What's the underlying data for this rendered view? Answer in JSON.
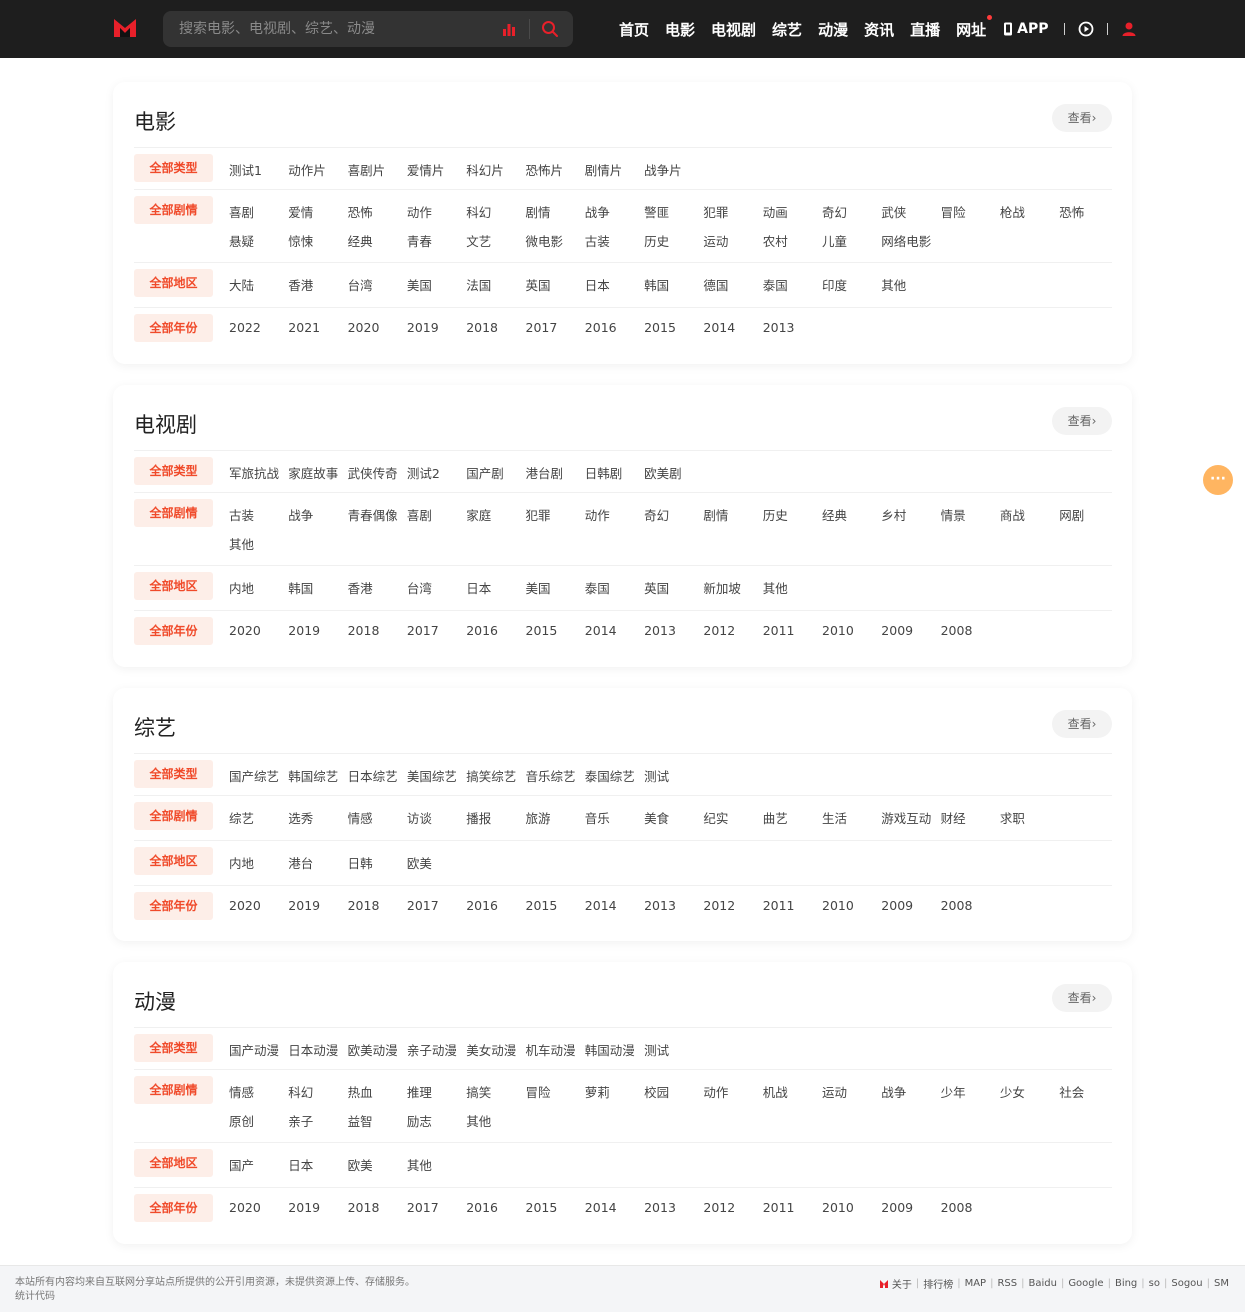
{
  "header": {
    "search_placeholder": "搜索电影、电视剧、综艺、动漫",
    "nav": [
      "首页",
      "电影",
      "电视剧",
      "综艺",
      "动漫",
      "资讯",
      "直播",
      "网址"
    ],
    "app_label": "APP",
    "brand_color": "#e8202a"
  },
  "more_label": "查看›",
  "filter_tags": [
    "全部类型",
    "全部剧情",
    "全部地区",
    "全部年份"
  ],
  "sections": [
    {
      "title": "电影",
      "more_label": "查看›",
      "rows": [
        {
          "tag": "全部类型",
          "items": [
            "测试1",
            "动作片",
            "喜剧片",
            "爱情片",
            "科幻片",
            "恐怖片",
            "剧情片",
            "战争片"
          ]
        },
        {
          "tag": "全部剧情",
          "items": [
            "喜剧",
            "爱情",
            "恐怖",
            "动作",
            "科幻",
            "剧情",
            "战争",
            "警匪",
            "犯罪",
            "动画",
            "奇幻",
            "武侠",
            "冒险",
            "枪战",
            "恐怖",
            "悬疑",
            "惊悚",
            "经典",
            "青春",
            "文艺",
            "微电影",
            "古装",
            "历史",
            "运动",
            "农村",
            "儿童",
            "网络电影"
          ]
        },
        {
          "tag": "全部地区",
          "items": [
            "大陆",
            "香港",
            "台湾",
            "美国",
            "法国",
            "英国",
            "日本",
            "韩国",
            "德国",
            "泰国",
            "印度",
            "其他"
          ]
        },
        {
          "tag": "全部年份",
          "items": [
            "2022",
            "2021",
            "2020",
            "2019",
            "2018",
            "2017",
            "2016",
            "2015",
            "2014",
            "2013"
          ]
        }
      ]
    },
    {
      "title": "电视剧",
      "more_label": "查看›",
      "rows": [
        {
          "tag": "全部类型",
          "items": [
            "军旅抗战",
            "家庭故事",
            "武侠传奇",
            "测试2",
            "国产剧",
            "港台剧",
            "日韩剧",
            "欧美剧"
          ]
        },
        {
          "tag": "全部剧情",
          "items": [
            "古装",
            "战争",
            "青春偶像",
            "喜剧",
            "家庭",
            "犯罪",
            "动作",
            "奇幻",
            "剧情",
            "历史",
            "经典",
            "乡村",
            "情景",
            "商战",
            "网剧",
            "其他"
          ]
        },
        {
          "tag": "全部地区",
          "items": [
            "内地",
            "韩国",
            "香港",
            "台湾",
            "日本",
            "美国",
            "泰国",
            "英国",
            "新加坡",
            "其他"
          ]
        },
        {
          "tag": "全部年份",
          "items": [
            "2020",
            "2019",
            "2018",
            "2017",
            "2016",
            "2015",
            "2014",
            "2013",
            "2012",
            "2011",
            "2010",
            "2009",
            "2008"
          ]
        }
      ]
    },
    {
      "title": "综艺",
      "more_label": "查看›",
      "rows": [
        {
          "tag": "全部类型",
          "items": [
            "国产综艺",
            "韩国综艺",
            "日本综艺",
            "美国综艺",
            "搞笑综艺",
            "音乐综艺",
            "泰国综艺",
            "测试"
          ]
        },
        {
          "tag": "全部剧情",
          "items": [
            "综艺",
            "选秀",
            "情感",
            "访谈",
            "播报",
            "旅游",
            "音乐",
            "美食",
            "纪实",
            "曲艺",
            "生活",
            "游戏互动",
            "财经",
            "求职"
          ]
        },
        {
          "tag": "全部地区",
          "items": [
            "内地",
            "港台",
            "日韩",
            "欧美"
          ]
        },
        {
          "tag": "全部年份",
          "items": [
            "2020",
            "2019",
            "2018",
            "2017",
            "2016",
            "2015",
            "2014",
            "2013",
            "2012",
            "2011",
            "2010",
            "2009",
            "2008"
          ]
        }
      ]
    },
    {
      "title": "动漫",
      "more_label": "查看›",
      "rows": [
        {
          "tag": "全部类型",
          "items": [
            "国产动漫",
            "日本动漫",
            "欧美动漫",
            "亲子动漫",
            "美女动漫",
            "机车动漫",
            "韩国动漫",
            "测试"
          ]
        },
        {
          "tag": "全部剧情",
          "items": [
            "情感",
            "科幻",
            "热血",
            "推理",
            "搞笑",
            "冒险",
            "萝莉",
            "校园",
            "动作",
            "机战",
            "运动",
            "战争",
            "少年",
            "少女",
            "社会",
            "原创",
            "亲子",
            "益智",
            "励志",
            "其他"
          ]
        },
        {
          "tag": "全部地区",
          "items": [
            "国产",
            "日本",
            "欧美",
            "其他"
          ]
        },
        {
          "tag": "全部年份",
          "items": [
            "2020",
            "2019",
            "2018",
            "2017",
            "2016",
            "2015",
            "2014",
            "2013",
            "2012",
            "2011",
            "2010",
            "2009",
            "2008"
          ]
        }
      ]
    }
  ],
  "footer": {
    "notice": "本站所有内容均来自互联网分享站点所提供的公开引用资源，未提供资源上传、存储服务。",
    "stats": "统计代码",
    "links": [
      "关于",
      "排行榜",
      "MAP",
      "RSS",
      "Baidu",
      "Google",
      "Bing",
      "so",
      "Sogou",
      "SM"
    ]
  }
}
